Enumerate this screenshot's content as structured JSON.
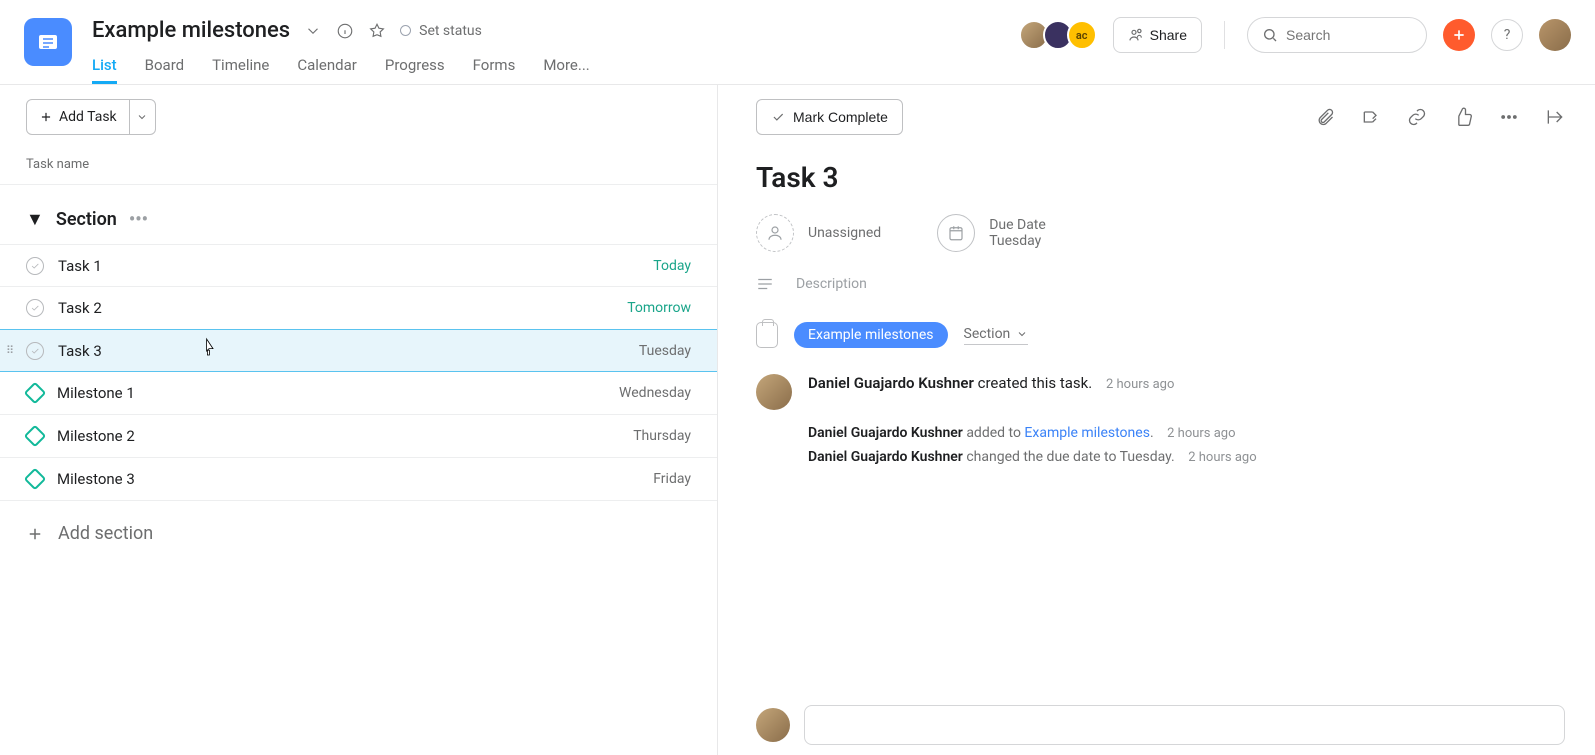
{
  "header": {
    "title": "Example milestones",
    "status_label": "Set status",
    "tabs": [
      "List",
      "Board",
      "Timeline",
      "Calendar",
      "Progress",
      "Forms",
      "More..."
    ],
    "active_tab": 0,
    "share_label": "Share",
    "search_placeholder": "Search",
    "avatar3_text": "ac"
  },
  "list": {
    "add_task_label": "Add Task",
    "column_header": "Task name",
    "section_name": "Section",
    "add_section_label": "Add section",
    "rows": [
      {
        "type": "task",
        "name": "Task 1",
        "date": "Today",
        "date_style": "green"
      },
      {
        "type": "task",
        "name": "Task 2",
        "date": "Tomorrow",
        "date_style": "green"
      },
      {
        "type": "task",
        "name": "Task 3",
        "date": "Tuesday",
        "date_style": "grey",
        "selected": true
      },
      {
        "type": "milestone",
        "name": "Milestone 1",
        "date": "Wednesday",
        "date_style": "grey"
      },
      {
        "type": "milestone",
        "name": "Milestone 2",
        "date": "Thursday",
        "date_style": "grey"
      },
      {
        "type": "milestone",
        "name": "Milestone 3",
        "date": "Friday",
        "date_style": "grey"
      }
    ]
  },
  "detail": {
    "complete_label": "Mark Complete",
    "title": "Task 3",
    "assignee_label": "Unassigned",
    "due_label": "Due Date",
    "due_value": "Tuesday",
    "description_placeholder": "Description",
    "project_pill": "Example milestones",
    "section_dd": "Section",
    "activity": {
      "creator": "Daniel Guajardo Kushner",
      "created_suffix": " created this task.",
      "created_time": "2 hours ago",
      "line1_actor": "Daniel Guajardo Kushner",
      "line1_mid": " added to ",
      "line1_link": "Example milestones",
      "line1_after": ".",
      "line1_time": "2 hours ago",
      "line2_actor": "Daniel Guajardo Kushner",
      "line2_rest": " changed the due date to Tuesday.",
      "line2_time": "2 hours ago"
    }
  }
}
